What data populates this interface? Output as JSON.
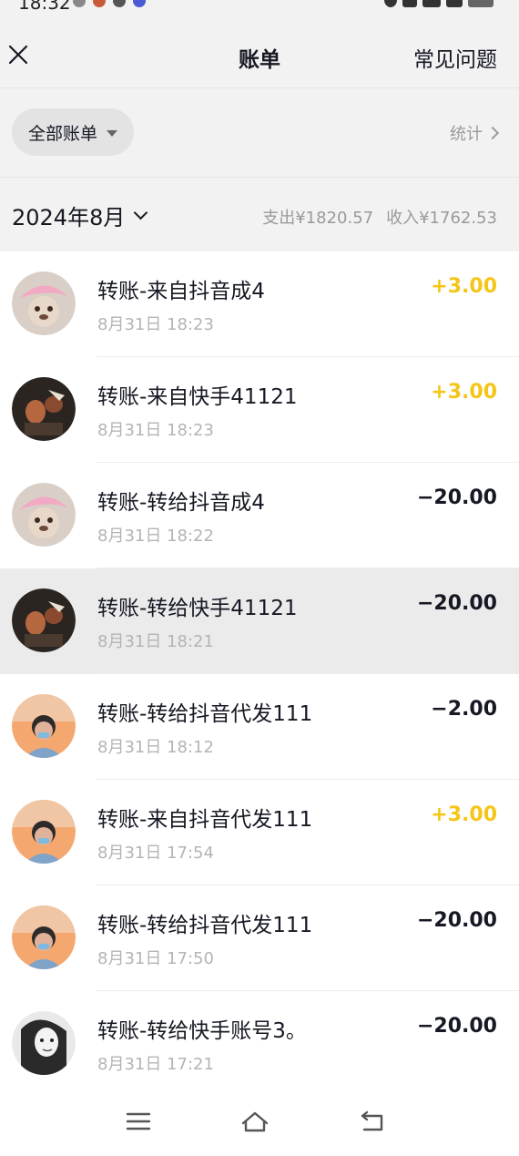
{
  "status_bar": {
    "time": "18:32"
  },
  "header": {
    "title": "账单",
    "faq_label": "常见问题"
  },
  "filter": {
    "chip_label": "全部账单",
    "stats_label": "统计"
  },
  "month": {
    "label": "2024年8月",
    "expense_label": "支出¥1820.57",
    "income_label": "收入¥1762.53"
  },
  "colors": {
    "income": "#f5c518",
    "expense": "#161823",
    "highlight_bg": "#ebebec"
  },
  "transactions": [
    {
      "title": "转账-来自抖音成4",
      "time": "8月31日 18:23",
      "amount": "+3.00",
      "type": "income",
      "avatar": "pink-hat-bear-avatar"
    },
    {
      "title": "转账-来自快手41121",
      "time": "8月31日 18:23",
      "amount": "+3.00",
      "type": "income",
      "avatar": "dark-photo-avatar"
    },
    {
      "title": "转账-转给抖音成4",
      "time": "8月31日 18:22",
      "amount": "−20.00",
      "type": "expense",
      "avatar": "pink-hat-bear-avatar"
    },
    {
      "title": "转账-转给快手41121",
      "time": "8月31日 18:21",
      "amount": "−20.00",
      "type": "expense",
      "avatar": "dark-photo-avatar",
      "highlighted": true
    },
    {
      "title": "转账-转给抖音代发111",
      "time": "8月31日 18:12",
      "amount": "−2.00",
      "type": "expense",
      "avatar": "sunset-person-avatar"
    },
    {
      "title": "转账-来自抖音代发111",
      "time": "8月31日 17:54",
      "amount": "+3.00",
      "type": "income",
      "avatar": "sunset-person-avatar"
    },
    {
      "title": "转账-转给抖音代发111",
      "time": "8月31日 17:50",
      "amount": "−20.00",
      "type": "expense",
      "avatar": "sunset-person-avatar"
    },
    {
      "title": "转账-转给快手账号3。",
      "time": "8月31日 17:21",
      "amount": "−20.00",
      "type": "expense",
      "avatar": "bw-portrait-avatar"
    }
  ]
}
